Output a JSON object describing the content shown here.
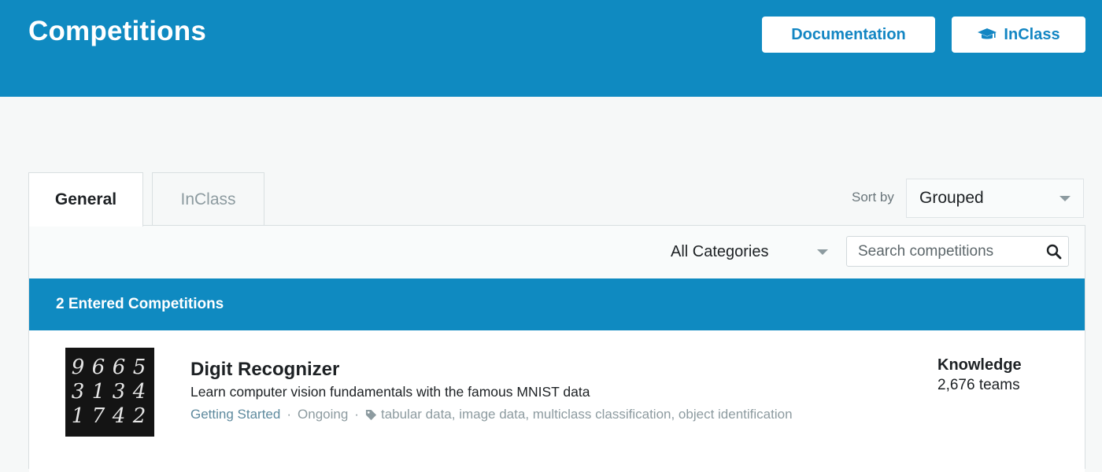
{
  "header": {
    "title": "Competitions",
    "buttons": {
      "documentation": "Documentation",
      "inclass": "InClass"
    }
  },
  "tabs": [
    {
      "label": "General",
      "active": true
    },
    {
      "label": "InClass",
      "active": false
    }
  ],
  "sort": {
    "label": "Sort by",
    "value": "Grouped"
  },
  "filters": {
    "category": "All Categories",
    "search_placeholder": "Search competitions"
  },
  "section": {
    "title": "2 Entered Competitions"
  },
  "competitions": [
    {
      "title": "Digit Recognizer",
      "description": "Learn computer vision fundamentals with the famous MNIST data",
      "category": "Getting Started",
      "status": "Ongoing",
      "tags": "tabular data, image data, multiclass classification, object identification",
      "reward": "Knowledge",
      "teams": "2,676 teams",
      "thumbnail_digits": [
        "9",
        "6",
        "6",
        "5",
        "3",
        "1",
        "3",
        "4",
        "1",
        "7",
        "4",
        "2"
      ]
    }
  ],
  "colors": {
    "brand": "#0f8ac1",
    "background": "#f6f8f8",
    "text": "#1d2124",
    "muted": "#8d9ba0",
    "link": "#5e8a9e"
  },
  "icons": {
    "inclass": "graduation-cap-icon",
    "search": "search-icon",
    "tag": "tag-icon",
    "dropdown": "chevron-down-icon"
  }
}
